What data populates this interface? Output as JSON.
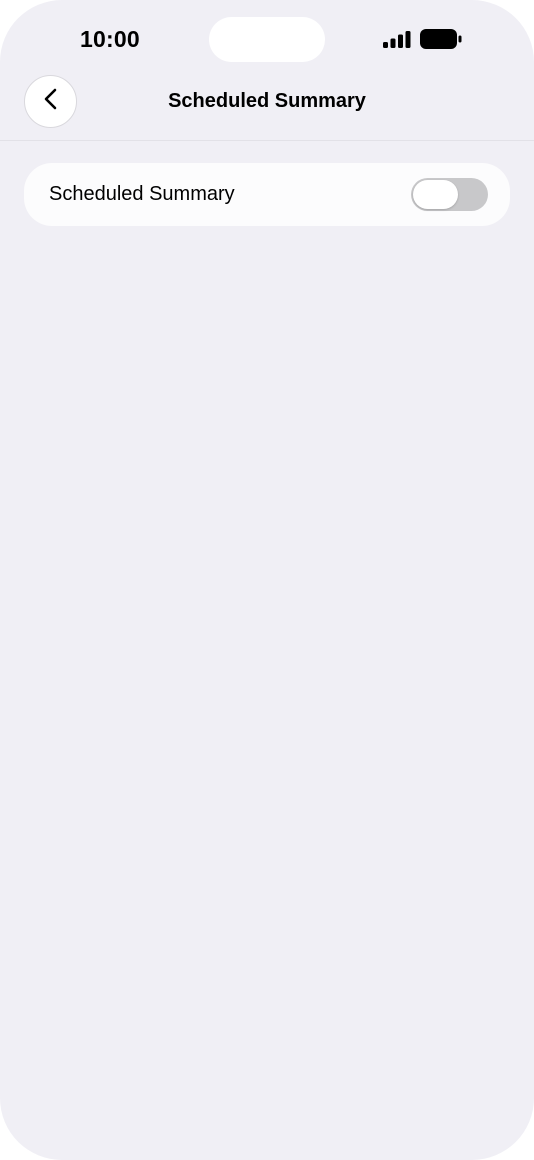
{
  "status_bar": {
    "time": "10:00",
    "signal_icon": "cellular-signal-icon",
    "battery_icon": "battery-icon"
  },
  "nav": {
    "back_icon": "chevron-left-icon",
    "title": "Scheduled Summary"
  },
  "settings": {
    "items": [
      {
        "label": "Scheduled Summary",
        "toggle_on": false
      }
    ]
  },
  "colors": {
    "background": "#f0eff5",
    "card": "#fcfcfd",
    "toggle_off": "#c8c8ca"
  }
}
